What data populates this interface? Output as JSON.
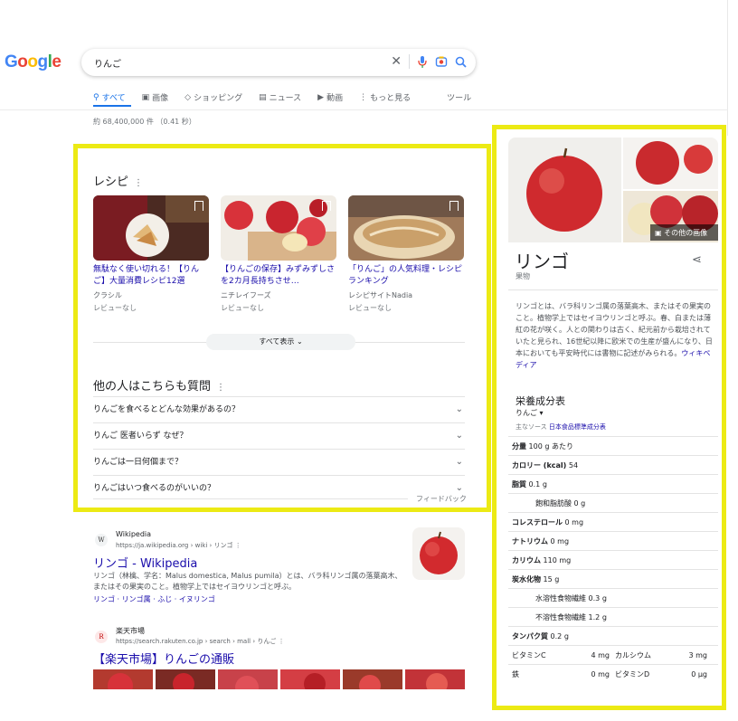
{
  "logo": {
    "letters": [
      "G",
      "o",
      "o",
      "g",
      "l",
      "e"
    ],
    "colors": [
      "#4285f4",
      "#ea4335",
      "#fbbc05",
      "#4285f4",
      "#34a853",
      "#ea4335"
    ]
  },
  "search": {
    "query": "りんご"
  },
  "tabs": [
    {
      "icon": "search-icon",
      "label": "すべて",
      "active": true
    },
    {
      "icon": "image-icon",
      "label": "画像"
    },
    {
      "icon": "tag-icon",
      "label": "ショッピング"
    },
    {
      "icon": "news-icon",
      "label": "ニュース"
    },
    {
      "icon": "video-icon",
      "label": "動画"
    },
    {
      "icon": "more-icon",
      "label": "もっと見る"
    }
  ],
  "tools_label": "ツール",
  "results_count": "約 68,400,000 件 （0.41 秒）",
  "recipes": {
    "title": "レシピ",
    "cards": [
      {
        "title": "無駄なく使い切れる！【りんご】大量消費レシピ12選",
        "source": "クラシル",
        "reviews": "レビューなし"
      },
      {
        "title": "【りんごの保存】みずみずしさを2カ月長持ちさせ…",
        "source": "ニチレイフーズ",
        "reviews": "レビューなし"
      },
      {
        "title": "「りんご」の人気料理・レシピランキング",
        "source": "レシピサイトNadia",
        "reviews": "レビューなし"
      }
    ],
    "show_all": "すべて表示"
  },
  "paa": {
    "title": "他の人はこちらも質問",
    "questions": [
      "りんごを食べるとどんな効果があるの？",
      "りんご 医者いらず なぜ？",
      "りんごは一日何個まで？",
      "りんごはいつ食べるのがいいの？"
    ],
    "feedback": "フィードバック"
  },
  "results": [
    {
      "site": "Wikipedia",
      "url": "https://ja.wikipedia.org › wiki › リンゴ",
      "title": "リンゴ - Wikipedia",
      "snippet": "リンゴ（林檎、学名：Malus domestica, Malus pumila）とは、バラ科リンゴ属の落葉高木、またはその果実のこと。植物学上ではセイヨウリンゴと呼ぶ。",
      "links": "リンゴ · リンゴ属 · ふじ · イヌリンゴ"
    },
    {
      "site": "楽天市場",
      "url": "https://search.rakuten.co.jp › search › mall › りんご",
      "title": "【楽天市場】りんごの通販"
    }
  ],
  "kp": {
    "more_images": "その他の画像",
    "title": "リンゴ",
    "subtitle": "果物",
    "description": "リンゴとは、バラ科リンゴ属の落葉高木、またはその果実のこと。植物学上ではセイヨウリンゴと呼ぶ。春、白または薄紅の花が咲く。人との関わりは古く、紀元前から栽培されていたと見られ、16世紀以降に欧米での生産が盛んになり、日本においても平安時代には書物に記述がみられる。",
    "wiki_link": "ウィキペディア",
    "nutrition_title": "栄養成分表",
    "nutrition_select": "りんご",
    "source_label": "主なソース",
    "source_link": "日本食品標準成分表",
    "rows": [
      {
        "label": "分量",
        "value": "100 g あたり"
      },
      {
        "label": "カロリー (kcal)",
        "value": "54"
      },
      {
        "label": "脂質",
        "value": "0.1 g"
      },
      {
        "label": "飽和脂肪酸",
        "value": "0 g",
        "indent": true
      },
      {
        "label": "コレステロール",
        "value": "0 mg"
      },
      {
        "label": "ナトリウム",
        "value": "0 mg"
      },
      {
        "label": "カリウム",
        "value": "110 mg"
      },
      {
        "label": "炭水化物",
        "value": "15 g"
      },
      {
        "label": "水溶性食物繊維",
        "value": "0.3 g",
        "indent": true
      },
      {
        "label": "不溶性食物繊維",
        "value": "1.2 g",
        "indent": true
      },
      {
        "label": "タンパク質",
        "value": "0.2 g"
      }
    ],
    "vitamins": [
      {
        "a": "ビタミンC",
        "av": "4 mg",
        "b": "カルシウム",
        "bv": "3 mg"
      },
      {
        "a": "鉄",
        "av": "0 mg",
        "b": "ビタミンD",
        "bv": "0 µg"
      }
    ]
  }
}
